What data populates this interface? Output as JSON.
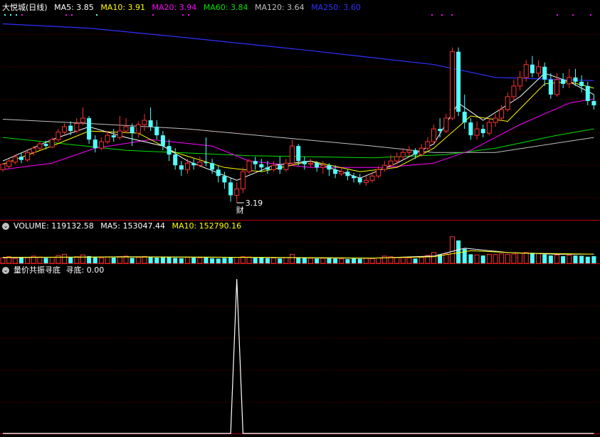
{
  "colors": {
    "bg": "#000000",
    "up": "#ff3232",
    "down": "#54ffff",
    "grid": "#800000",
    "ma5": "#ffffff",
    "ma10": "#ffff00",
    "ma20": "#ff00ff",
    "ma60": "#00e000",
    "ma120": "#c0c0c0",
    "ma250": "#3030ff"
  },
  "price_panel": {
    "title": "大悦城(日线)",
    "ma5_label": "MA5: 3.85",
    "ma10_label": "MA10: 3.91",
    "ma20_label": "MA20: 3.94",
    "ma60_label": "MA60: 3.84",
    "ma120_label": "MA120: 3.64",
    "ma250_label": "MA250: 3.60",
    "low_marker": "3.19",
    "event_marker": "财"
  },
  "volume_panel": {
    "icon": "chevron-down-icon",
    "vol_label": "VOLUME: 119132.58",
    "ma5_label": "MA5: 153047.44",
    "ma10_label": "MA10: 152790.16"
  },
  "indicator_panel": {
    "icon": "chevron-down-icon",
    "name_label": "量价共振寻底",
    "value_label": "寻底: 0.00"
  },
  "chart_data": [
    {
      "type": "candlestick",
      "title": "大悦城(日线)",
      "series_lines": [
        "MA5",
        "MA10",
        "MA20",
        "MA60",
        "MA120",
        "MA250"
      ],
      "ylim": [
        3.05,
        4.95
      ],
      "candles": [
        [
          3.5,
          3.55,
          3.48,
          3.56
        ],
        [
          3.53,
          3.58,
          3.51,
          3.6
        ],
        [
          3.57,
          3.62,
          3.55,
          3.64
        ],
        [
          3.62,
          3.59,
          3.56,
          3.65
        ],
        [
          3.59,
          3.66,
          3.57,
          3.68
        ],
        [
          3.66,
          3.7,
          3.63,
          3.72
        ],
        [
          3.7,
          3.74,
          3.68,
          3.76
        ],
        [
          3.74,
          3.72,
          3.69,
          3.77
        ],
        [
          3.71,
          3.78,
          3.7,
          3.8
        ],
        [
          3.78,
          3.85,
          3.76,
          3.88
        ],
        [
          3.85,
          3.9,
          3.83,
          3.93
        ],
        [
          3.91,
          3.86,
          3.82,
          3.95
        ],
        [
          3.86,
          3.93,
          3.84,
          3.98
        ],
        [
          3.94,
          3.98,
          3.91,
          4.08
        ],
        [
          3.98,
          3.78,
          3.74,
          4.0
        ],
        [
          3.78,
          3.7,
          3.66,
          3.82
        ],
        [
          3.7,
          3.76,
          3.68,
          3.8
        ],
        [
          3.76,
          3.82,
          3.74,
          3.86
        ],
        [
          3.82,
          3.8,
          3.76,
          3.88
        ],
        [
          3.8,
          3.86,
          3.78,
          4.0
        ],
        [
          3.86,
          3.9,
          3.84,
          3.98
        ],
        [
          3.9,
          3.84,
          3.72,
          3.93
        ],
        [
          3.84,
          3.92,
          3.8,
          3.95
        ],
        [
          3.92,
          3.96,
          3.86,
          4.02
        ],
        [
          3.96,
          3.9,
          3.86,
          4.08
        ],
        [
          3.9,
          3.82,
          3.78,
          3.96
        ],
        [
          3.82,
          3.72,
          3.68,
          3.86
        ],
        [
          3.72,
          3.64,
          3.58,
          3.78
        ],
        [
          3.64,
          3.54,
          3.5,
          3.7
        ],
        [
          3.54,
          3.5,
          3.44,
          3.58
        ],
        [
          3.5,
          3.56,
          3.46,
          3.6
        ],
        [
          3.56,
          3.54,
          3.5,
          3.6
        ],
        [
          3.54,
          3.57,
          3.52,
          3.62
        ],
        [
          3.57,
          3.56,
          3.53,
          3.8
        ],
        [
          3.56,
          3.5,
          3.46,
          3.6
        ],
        [
          3.5,
          3.44,
          3.38,
          3.54
        ],
        [
          3.44,
          3.38,
          3.32,
          3.48
        ],
        [
          3.38,
          3.26,
          3.2,
          3.42
        ],
        [
          3.26,
          3.32,
          3.19,
          3.38
        ],
        [
          3.32,
          3.48,
          3.28,
          3.52
        ],
        [
          3.48,
          3.58,
          3.46,
          3.6
        ],
        [
          3.58,
          3.55,
          3.5,
          3.62
        ],
        [
          3.55,
          3.52,
          3.48,
          3.6
        ],
        [
          3.52,
          3.5,
          3.46,
          3.58
        ],
        [
          3.5,
          3.54,
          3.48,
          3.58
        ],
        [
          3.54,
          3.5,
          3.46,
          3.62
        ],
        [
          3.5,
          3.56,
          3.48,
          3.6
        ],
        [
          3.56,
          3.72,
          3.54,
          3.78
        ],
        [
          3.72,
          3.58,
          3.54,
          3.74
        ],
        [
          3.58,
          3.55,
          3.5,
          3.62
        ],
        [
          3.55,
          3.56,
          3.52,
          3.6
        ],
        [
          3.56,
          3.52,
          3.48,
          3.58
        ],
        [
          3.52,
          3.54,
          3.46,
          3.58
        ],
        [
          3.54,
          3.5,
          3.44,
          3.56
        ],
        [
          3.5,
          3.46,
          3.42,
          3.54
        ],
        [
          3.46,
          3.48,
          3.44,
          3.52
        ],
        [
          3.48,
          3.44,
          3.4,
          3.5
        ],
        [
          3.44,
          3.42,
          3.38,
          3.47
        ],
        [
          3.42,
          3.38,
          3.36,
          3.46
        ],
        [
          3.38,
          3.4,
          3.35,
          3.44
        ],
        [
          3.4,
          3.44,
          3.38,
          3.48
        ],
        [
          3.44,
          3.5,
          3.42,
          3.53
        ],
        [
          3.5,
          3.54,
          3.48,
          3.58
        ],
        [
          3.54,
          3.58,
          3.52,
          3.64
        ],
        [
          3.58,
          3.62,
          3.55,
          3.66
        ],
        [
          3.62,
          3.66,
          3.59,
          3.7
        ],
        [
          3.66,
          3.68,
          3.63,
          3.72
        ],
        [
          3.68,
          3.64,
          3.6,
          3.7
        ],
        [
          3.64,
          3.7,
          3.62,
          3.74
        ],
        [
          3.7,
          3.76,
          3.68,
          3.8
        ],
        [
          3.76,
          3.88,
          3.74,
          3.92
        ],
        [
          3.88,
          3.86,
          3.8,
          3.98
        ],
        [
          3.86,
          3.98,
          3.84,
          4.02
        ],
        [
          3.98,
          4.6,
          3.96,
          4.64
        ],
        [
          4.6,
          4.04,
          4.0,
          4.64
        ],
        [
          4.04,
          3.94,
          3.88,
          4.2
        ],
        [
          3.94,
          3.82,
          3.78,
          3.98
        ],
        [
          3.82,
          3.88,
          3.78,
          3.95
        ],
        [
          3.88,
          3.84,
          3.8,
          3.92
        ],
        [
          3.84,
          3.94,
          3.82,
          3.98
        ],
        [
          3.94,
          3.98,
          3.9,
          4.02
        ],
        [
          3.98,
          4.06,
          3.95,
          4.1
        ],
        [
          4.06,
          4.18,
          4.04,
          4.22
        ],
        [
          4.18,
          4.28,
          4.14,
          4.34
        ],
        [
          4.28,
          4.36,
          4.24,
          4.42
        ],
        [
          4.36,
          4.48,
          4.32,
          4.52
        ],
        [
          4.48,
          4.4,
          4.36,
          4.56
        ],
        [
          4.4,
          4.46,
          4.36,
          4.52
        ],
        [
          4.46,
          4.34,
          4.28,
          4.5
        ],
        [
          4.34,
          4.2,
          4.16,
          4.4
        ],
        [
          4.2,
          4.34,
          4.18,
          4.4
        ],
        [
          4.34,
          4.3,
          4.26,
          4.4
        ],
        [
          4.3,
          4.36,
          4.26,
          4.44
        ],
        [
          4.36,
          4.32,
          4.28,
          4.44
        ],
        [
          4.32,
          4.28,
          4.22,
          4.38
        ],
        [
          4.28,
          4.14,
          4.1,
          4.32
        ],
        [
          4.14,
          4.1,
          4.06,
          4.2
        ]
      ],
      "ma250": [
        [
          0,
          4.86
        ],
        [
          14,
          4.82
        ],
        [
          30,
          4.73
        ],
        [
          50,
          4.61
        ],
        [
          70,
          4.48
        ],
        [
          80,
          4.36
        ],
        [
          96,
          4.33
        ]
      ],
      "ma120": [
        [
          0,
          3.97
        ],
        [
          14,
          3.93
        ],
        [
          30,
          3.88
        ],
        [
          45,
          3.8
        ],
        [
          60,
          3.72
        ],
        [
          70,
          3.66
        ],
        [
          80,
          3.66
        ],
        [
          96,
          3.8
        ]
      ],
      "ma60": [
        [
          0,
          3.8
        ],
        [
          10,
          3.74
        ],
        [
          20,
          3.68
        ],
        [
          40,
          3.63
        ],
        [
          60,
          3.61
        ],
        [
          72,
          3.64
        ],
        [
          80,
          3.7
        ],
        [
          90,
          3.82
        ],
        [
          96,
          3.88
        ]
      ],
      "ma20": [
        [
          0,
          3.5
        ],
        [
          8,
          3.56
        ],
        [
          15,
          3.7
        ],
        [
          24,
          3.78
        ],
        [
          34,
          3.72
        ],
        [
          40,
          3.58
        ],
        [
          50,
          3.52
        ],
        [
          62,
          3.52
        ],
        [
          70,
          3.56
        ],
        [
          76,
          3.68
        ],
        [
          84,
          3.92
        ],
        [
          92,
          4.12
        ],
        [
          96,
          4.16
        ]
      ],
      "ma10": [
        [
          0,
          3.55
        ],
        [
          8,
          3.72
        ],
        [
          14,
          3.86
        ],
        [
          22,
          3.84
        ],
        [
          28,
          3.66
        ],
        [
          36,
          3.52
        ],
        [
          42,
          3.48
        ],
        [
          50,
          3.58
        ],
        [
          58,
          3.48
        ],
        [
          64,
          3.52
        ],
        [
          70,
          3.7
        ],
        [
          76,
          4.0
        ],
        [
          82,
          3.95
        ],
        [
          88,
          4.3
        ],
        [
          92,
          4.32
        ],
        [
          96,
          4.26
        ]
      ],
      "ma5": [
        [
          0,
          3.58
        ],
        [
          8,
          3.78
        ],
        [
          14,
          3.9
        ],
        [
          20,
          3.8
        ],
        [
          26,
          3.72
        ],
        [
          30,
          3.58
        ],
        [
          38,
          3.4
        ],
        [
          44,
          3.54
        ],
        [
          50,
          3.58
        ],
        [
          58,
          3.42
        ],
        [
          64,
          3.56
        ],
        [
          70,
          3.74
        ],
        [
          74,
          4.12
        ],
        [
          78,
          3.96
        ],
        [
          84,
          4.18
        ],
        [
          88,
          4.4
        ],
        [
          92,
          4.32
        ],
        [
          96,
          4.2
        ]
      ],
      "annotation": {
        "index": 38,
        "value": 3.19
      }
    },
    {
      "type": "bar",
      "title": "VOLUME",
      "ylim": [
        0,
        520000
      ],
      "values": [
        90000,
        110000,
        80000,
        100000,
        95000,
        120000,
        105000,
        90000,
        100000,
        130000,
        150000,
        95000,
        110000,
        140000,
        120000,
        100000,
        90000,
        105000,
        95000,
        110000,
        120000,
        90000,
        100000,
        115000,
        105000,
        95000,
        110000,
        100000,
        90000,
        85000,
        100000,
        95000,
        90000,
        105000,
        85000,
        80000,
        90000,
        95000,
        100000,
        110000,
        105000,
        90000,
        95000,
        85000,
        90000,
        80000,
        95000,
        150000,
        100000,
        90000,
        85000,
        80000,
        85000,
        90000,
        80000,
        75000,
        70000,
        80000,
        75000,
        85000,
        80000,
        90000,
        120000,
        110000,
        100000,
        95000,
        90000,
        80000,
        100000,
        130000,
        180000,
        150000,
        160000,
        440000,
        380000,
        240000,
        150000,
        140000,
        130000,
        150000,
        145000,
        160000,
        150000,
        155000,
        170000,
        180000,
        175000,
        165000,
        150000,
        130000,
        140000,
        120000,
        135000,
        130000,
        125000,
        110000,
        119132.58
      ],
      "ma5_line": [
        [
          0,
          95000
        ],
        [
          20,
          110000
        ],
        [
          46,
          95000
        ],
        [
          60,
          85000
        ],
        [
          70,
          120000
        ],
        [
          75,
          250000
        ],
        [
          82,
          180000
        ],
        [
          90,
          150000
        ],
        [
          96,
          153047.44
        ]
      ],
      "ma10_line": [
        [
          0,
          100000
        ],
        [
          20,
          105000
        ],
        [
          46,
          98000
        ],
        [
          60,
          88000
        ],
        [
          70,
          110000
        ],
        [
          76,
          210000
        ],
        [
          84,
          170000
        ],
        [
          96,
          152790.16
        ]
      ]
    },
    {
      "type": "line",
      "title": "量价共振寻底",
      "ylim": [
        0,
        1
      ],
      "values_sparse": [
        [
          37,
          0
        ],
        [
          38,
          1
        ],
        [
          39,
          0
        ]
      ],
      "n": 97
    }
  ]
}
